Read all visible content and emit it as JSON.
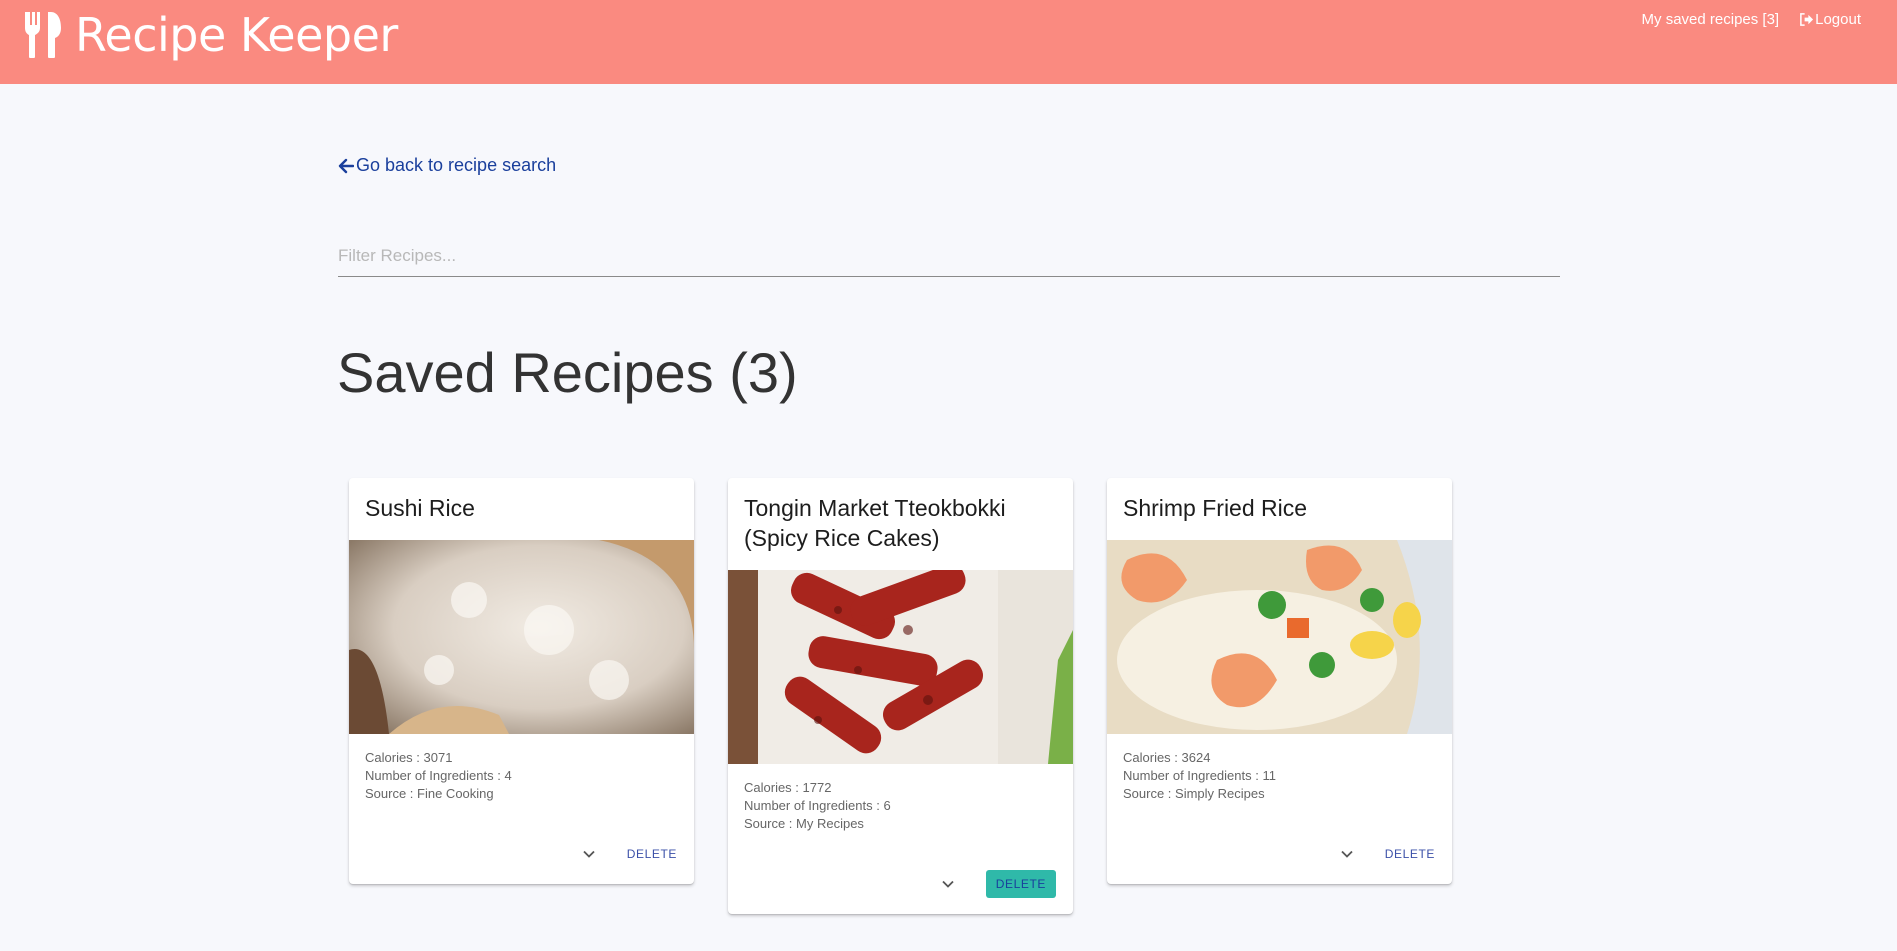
{
  "header": {
    "brand_title": "Recipe Keeper",
    "saved_link": "My saved recipes [3]",
    "logout_link": "Logout",
    "bg_color": "#fa8a80"
  },
  "back_link": "Go back to recipe search",
  "filter": {
    "placeholder": "Filter Recipes...",
    "value": ""
  },
  "page_title": "Saved Recipes (3)",
  "delete_label": "DELETE",
  "recipes": [
    {
      "title": "Sushi Rice",
      "calories": "Calories : 3071",
      "ingredients": "Number of Ingredients : 4",
      "source": "Source : Fine Cooking"
    },
    {
      "title": "Tongin Market Tteokbokki (Spicy Rice Cakes)",
      "calories": "Calories : 1772",
      "ingredients": "Number of Ingredients : 6",
      "source": "Source : My Recipes"
    },
    {
      "title": "Shrimp Fried Rice",
      "calories": "Calories : 3624",
      "ingredients": "Number of Ingredients : 11",
      "source": "Source : Simply Recipes"
    }
  ],
  "icons": {
    "brand": "utensils-icon",
    "logout": "logout-icon",
    "back": "arrow-left-icon",
    "expand": "chevron-down-icon"
  }
}
